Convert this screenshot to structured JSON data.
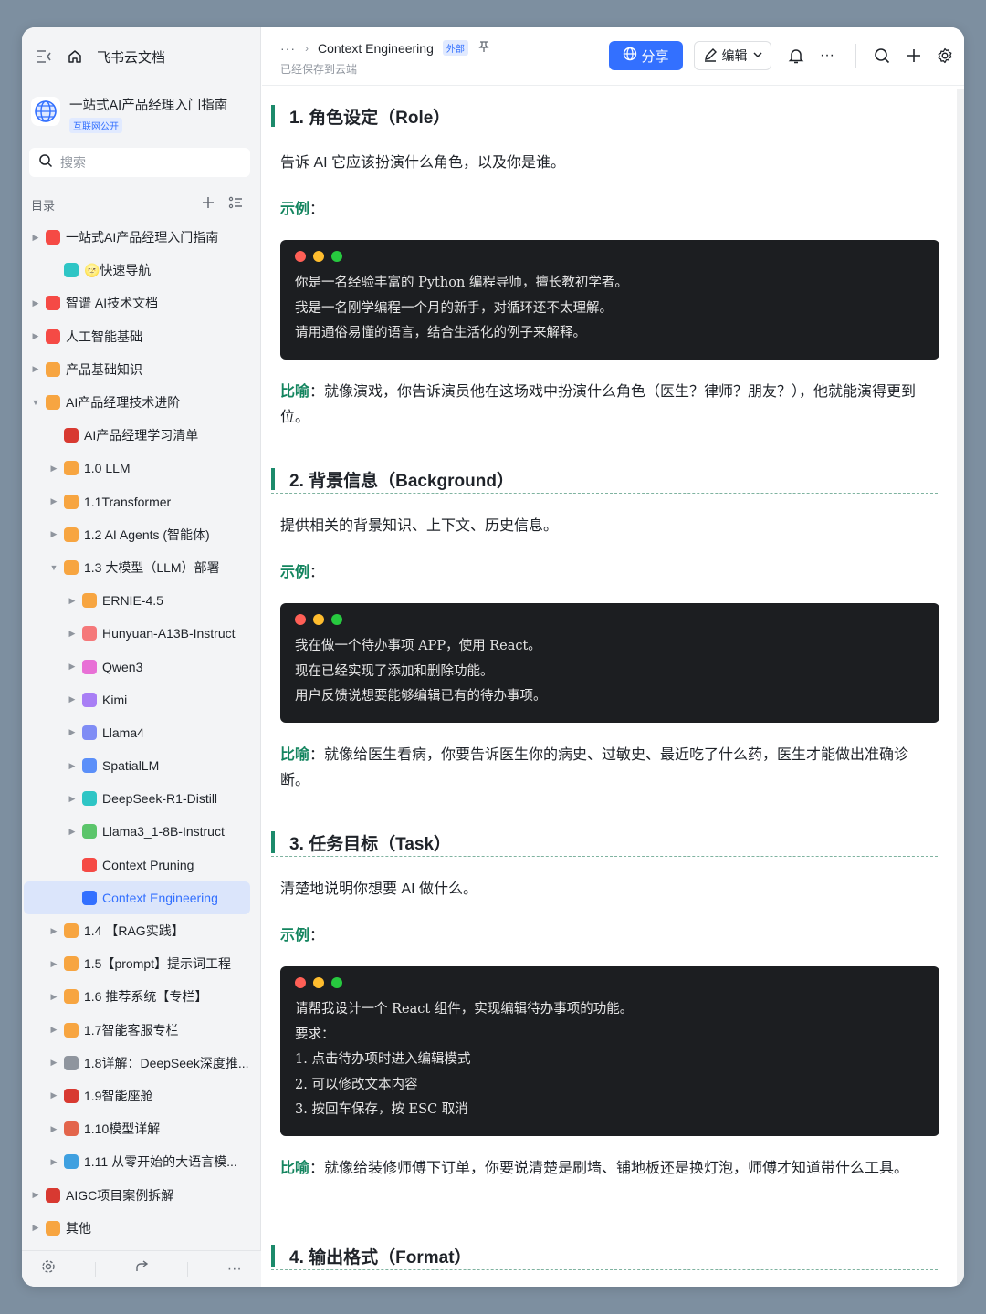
{
  "app": {
    "brand": "飞书云文档",
    "doc_title": "一站式AI产品经理入门指南",
    "doc_tag": "互联网公开"
  },
  "search": {
    "placeholder": "搜索"
  },
  "toc": {
    "label": "目录"
  },
  "tree": [
    {
      "label": "一站式AI产品经理入门指南",
      "icon": "target-icon",
      "color": "#f54a45",
      "depth": 0,
      "arrow": "right"
    },
    {
      "label": "🌝快速导航",
      "icon": "doc-icon",
      "color": "#2ec5c5",
      "depth": 1,
      "arrow": ""
    },
    {
      "label": "智谱 AI技术文档",
      "icon": "notebook-icon",
      "color": "#f54a45",
      "depth": 0,
      "arrow": "right"
    },
    {
      "label": "人工智能基础",
      "icon": "smile-icon",
      "color": "#f54a45",
      "depth": 0,
      "arrow": "right"
    },
    {
      "label": "产品基础知识",
      "icon": "folder-icon",
      "color": "#f7a541",
      "depth": 0,
      "arrow": "right"
    },
    {
      "label": "AI产品经理技术进阶",
      "icon": "folder-icon",
      "color": "#f7a541",
      "depth": 0,
      "arrow": "down"
    },
    {
      "label": "AI产品经理学习清单",
      "icon": "floppy-icon",
      "color": "#d83931",
      "depth": 1,
      "arrow": ""
    },
    {
      "label": "1.0 LLM",
      "icon": "grid-icon",
      "color": "#f7a541",
      "depth": 1,
      "arrow": "right"
    },
    {
      "label": "1.1Transformer",
      "icon": "grid-icon",
      "color": "#f7a541",
      "depth": 1,
      "arrow": "right"
    },
    {
      "label": "1.2 AI Agents (智能体)",
      "icon": "grid-icon",
      "color": "#f7a541",
      "depth": 1,
      "arrow": "right"
    },
    {
      "label": "1.3 大模型（LLM）部署",
      "icon": "grid-icon",
      "color": "#f7a541",
      "depth": 1,
      "arrow": "down"
    },
    {
      "label": "ERNIE-4.5",
      "icon": "bolt-icon",
      "color": "#f7a541",
      "depth": 2,
      "arrow": "right"
    },
    {
      "label": "Hunyuan-A13B-Instruct",
      "icon": "bolt-icon",
      "color": "#f5787a",
      "depth": 2,
      "arrow": "right"
    },
    {
      "label": "Qwen3",
      "icon": "bolt-icon",
      "color": "#e870d6",
      "depth": 2,
      "arrow": "right"
    },
    {
      "label": "Kimi",
      "icon": "bolt-icon",
      "color": "#a87ef5",
      "depth": 2,
      "arrow": "right"
    },
    {
      "label": "Llama4",
      "icon": "bolt-icon",
      "color": "#7f8cf5",
      "depth": 2,
      "arrow": "right"
    },
    {
      "label": "SpatialLM",
      "icon": "bolt-icon",
      "color": "#5b8ff9",
      "depth": 2,
      "arrow": "right"
    },
    {
      "label": "DeepSeek-R1-Distill",
      "icon": "bolt-icon",
      "color": "#2ec5c5",
      "depth": 2,
      "arrow": "right"
    },
    {
      "label": "Llama3_1-8B-Instruct",
      "icon": "bolt-icon",
      "color": "#5bc56b",
      "depth": 2,
      "arrow": "right"
    },
    {
      "label": "Context Pruning",
      "icon": "target-icon",
      "color": "#f54a45",
      "depth": 2,
      "arrow": ""
    },
    {
      "label": "Context Engineering",
      "icon": "doc-icon",
      "color": "#3370ff",
      "depth": 2,
      "arrow": "",
      "active": true
    },
    {
      "label": "1.4 【RAG实践】",
      "icon": "grid-icon",
      "color": "#f7a541",
      "depth": 1,
      "arrow": "right"
    },
    {
      "label": "1.5【prompt】提示词工程",
      "icon": "grid-icon",
      "color": "#f7a541",
      "depth": 1,
      "arrow": "right"
    },
    {
      "label": "1.6 推荐系统【专栏】",
      "icon": "grid-icon",
      "color": "#f7a541",
      "depth": 1,
      "arrow": "right"
    },
    {
      "label": "1.7智能客服专栏",
      "icon": "grid-icon",
      "color": "#f7a541",
      "depth": 1,
      "arrow": "right"
    },
    {
      "label": "1.8详解：DeepSeek深度推...",
      "icon": "gear-icon",
      "color": "#8f959e",
      "depth": 1,
      "arrow": "right"
    },
    {
      "label": "1.9智能座舱",
      "icon": "car-icon",
      "color": "#d83931",
      "depth": 1,
      "arrow": "right"
    },
    {
      "label": "1.10模型详解",
      "icon": "tools-icon",
      "color": "#e3654c",
      "depth": 1,
      "arrow": "right"
    },
    {
      "label": "1.11 从零开始的大语言模...",
      "icon": "kite-icon",
      "color": "#3fa0e0",
      "depth": 1,
      "arrow": "right"
    },
    {
      "label": "AIGC项目案例拆解",
      "icon": "floppy-icon",
      "color": "#d83931",
      "depth": 0,
      "arrow": "right"
    },
    {
      "label": "其他",
      "icon": "folder-icon",
      "color": "#f7a541",
      "depth": 0,
      "arrow": "right"
    }
  ],
  "header": {
    "crumb_dots": "···",
    "crumb_title": "Context Engineering",
    "crumb_tag": "外部",
    "saved": "已经保存到云端",
    "share": "分享",
    "edit": "编辑"
  },
  "sections": [
    {
      "title": "1. 角色设定（Role）",
      "desc": "告诉 AI 它应该扮演什么角色，以及你是谁。",
      "example_label": "示例",
      "code": [
        "你是一名经验丰富的 Python 编程导师，擅长教初学者。",
        "我是一名刚学编程一个月的新手，对循环还不太理解。",
        "请用通俗易懂的语言，结合生活化的例子来解释。"
      ],
      "cmp_label": "比喻",
      "cmp_text": "：就像演戏，你告诉演员他在这场戏中扮演什么角色（医生？律师？朋友？），他就能演得更到位。"
    },
    {
      "title": "2. 背景信息（Background）",
      "desc": "提供相关的背景知识、上下文、历史信息。",
      "example_label": "示例",
      "code": [
        "我在做一个待办事项 APP，使用 React。",
        "现在已经实现了添加和删除功能。",
        "用户反馈说想要能够编辑已有的待办事项。"
      ],
      "cmp_label": "比喻",
      "cmp_text": "：就像给医生看病，你要告诉医生你的病史、过敏史、最近吃了什么药，医生才能做出准确诊断。"
    },
    {
      "title": "3. 任务目标（Task）",
      "desc": "清楚地说明你想要 AI 做什么。",
      "example_label": "示例",
      "code": [
        "请帮我设计一个 React 组件，实现编辑待办事项的功能。",
        "要求：",
        "1. 点击待办项时进入编辑模式",
        "2. 可以修改文本内容",
        "3. 按回车保存，按 ESC 取消"
      ],
      "cmp_label": "比喻",
      "cmp_text": "：就像给装修师傅下订单，你要说清楚是刷墙、铺地板还是换灯泡，师傅才知道带什么工具。"
    },
    {
      "title": "4. 输出格式（Format）"
    }
  ],
  "colors": {
    "accent": "#3370ff",
    "heading_bar": "#1c8a6b",
    "example_green": "#14855f",
    "code_bg": "#1c1e21",
    "light_red": "#ff5f56",
    "light_yellow": "#ffbd2e",
    "light_green": "#27c93f"
  }
}
